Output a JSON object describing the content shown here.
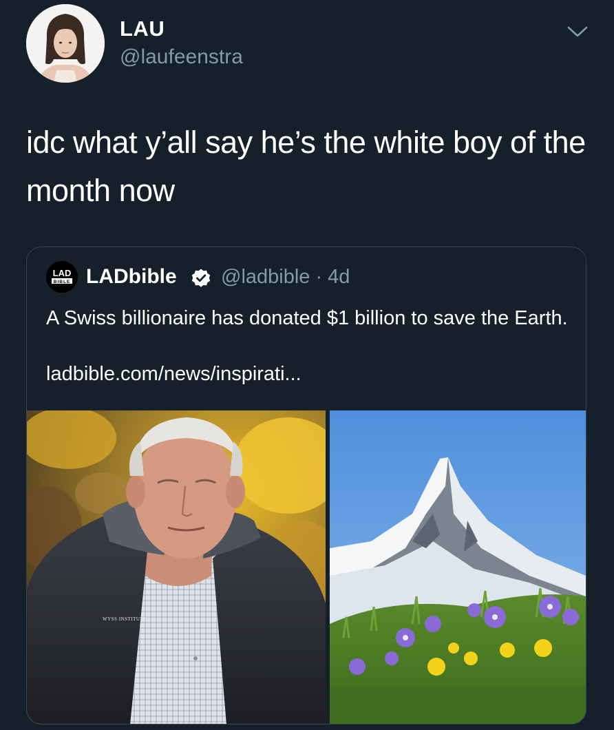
{
  "author": {
    "display_name": "LAU",
    "handle": "@laufeenstra",
    "avatar_icon": "profile-photo-avatar"
  },
  "menu": {
    "icon": "chevron-down-icon"
  },
  "tweet": {
    "text": "idc what y’all say he’s the white boy of the month now"
  },
  "quoted_tweet": {
    "logo_text_top": "LAD",
    "logo_text_bottom": "BIBLE",
    "display_name": "LADbible",
    "verified_icon": "verified-badge-icon",
    "handle_time": "@ladbible · 4d",
    "text": "A Swiss billionaire has donated $1 billion to save the Earth.",
    "link": "ladbible.com/news/inspirati...",
    "images": [
      {
        "name": "photo-elderly-man-in-vest",
        "vest_logo": "WYSS INSTITUTE"
      },
      {
        "name": "photo-matterhorn-with-flowers"
      }
    ]
  },
  "colors": {
    "background": "#15202b",
    "text_primary": "#ffffff",
    "text_secondary": "#8899a6",
    "border": "#38444d",
    "verified_badge": "#ffffff"
  }
}
